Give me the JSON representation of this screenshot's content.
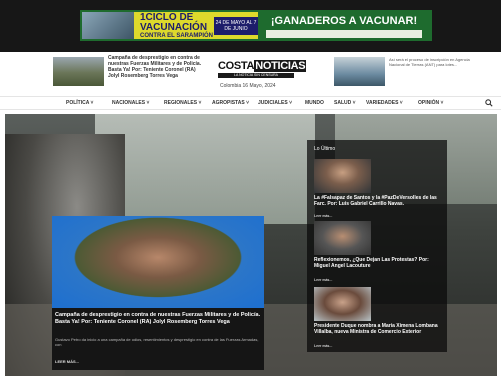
{
  "ad": {
    "title": "1CICLO DE VACUNACIÓN",
    "subtitle": "CONTRA EL SARAMPIÓN",
    "dates": "24 DE MAYO AL 7 DE JUNIO",
    "slogan": "¡GANADEROS A VACUNAR!"
  },
  "header": {
    "article_left": "Campaña de desprestigio en contra de nuestras Fuerzas Militares y de Policía. Basta Ya! Por: Teniente Coronel (RA) Jolyl Rosemberg Torres Vega",
    "article_right": "Así será el proceso de inscripción en Agencia Nacional de Tierras (ANT) para lotes...",
    "logo_word1": "COSTA",
    "logo_word2": "NOTICIAS",
    "logo_tagline": "LA NOTICIA SIN CENSURA",
    "date": "Colombia 16 Mayo, 2024"
  },
  "nav": {
    "items": [
      "POLÍTICA ˅",
      "NACIONALES ˅",
      "REGIONALES ˅",
      "AGROPISTAS ˅",
      "JUDICIALES ˅",
      "MUNDO",
      "SALUD ˅",
      "VARIEDADES ˅",
      "OPINIÓN ˅"
    ]
  },
  "feature": {
    "title": "Campaña de desprestigio en contra de nuestras Fuerzas Militares y de Policía. Basta Ya! Por: Teniente Coronel (RA) Jolyl Rosemberg Torres Vega",
    "excerpt": "Gustavo Petro da inicio a una campaña de odios, resentimientos y desprestigio en contra de las Fuerzas Armadas, con",
    "more": "LEER MÁS..."
  },
  "sidebar": {
    "heading": "Lo Último",
    "items": [
      {
        "title": "La #Falsapaz de Santos y la #PazDeVersolles de las Farc. Por: Luis Gabriel Carrillo Navas.",
        "more": "Leer más..."
      },
      {
        "title": "Reflexionemos, ¿Que Dejan Las Protestas? Por: Miguel Angel Lacouture",
        "more": "Leer más..."
      },
      {
        "title": "Presidente Duque nombra a María Ximena Lombana Villalba, nueva Ministra de Comercio Exterior",
        "more": "Leer más..."
      }
    ]
  },
  "colors": {
    "ad_yellow": "#ddd92c",
    "ad_green": "#1e6b2e",
    "hero_dark": "#262826"
  }
}
